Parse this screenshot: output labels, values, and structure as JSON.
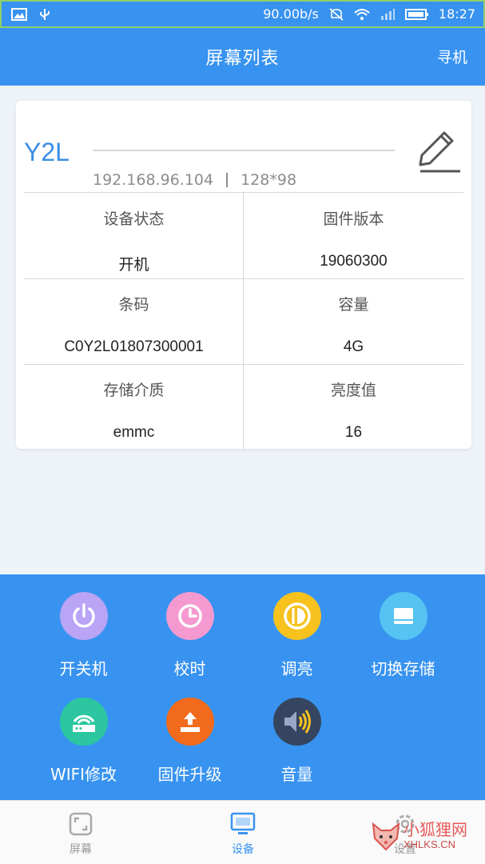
{
  "status_bar": {
    "speed": "90.00b/s",
    "time": "18:27"
  },
  "header": {
    "title": "屏幕列表",
    "action": "寻机"
  },
  "device": {
    "name": "Y2L",
    "ip": "192.168.96.104",
    "resolution": "128*98"
  },
  "info": [
    {
      "label": "设备状态",
      "value": "开机"
    },
    {
      "label": "固件版本",
      "value": "19060300"
    },
    {
      "label": "条码",
      "value": "C0Y2L01807300001"
    },
    {
      "label": "容量",
      "value": "4G"
    },
    {
      "label": "存储介质",
      "value": "emmc"
    },
    {
      "label": "亮度值",
      "value": "16"
    }
  ],
  "controls": [
    {
      "label": "开关机",
      "icon": "power-icon",
      "color": "#b9a4f5"
    },
    {
      "label": "校时",
      "icon": "clock-icon",
      "color": "#f59ad0"
    },
    {
      "label": "调亮",
      "icon": "brightness-icon",
      "color": "#f7c21e"
    },
    {
      "label": "切换存储",
      "icon": "storage-icon",
      "color": "#56c4f2"
    },
    {
      "label": "WIFI修改",
      "icon": "wifi-router-icon",
      "color": "#2cc7a0"
    },
    {
      "label": "固件升级",
      "icon": "upload-icon",
      "color": "#f26a1b"
    },
    {
      "label": "音量",
      "icon": "volume-icon",
      "color": "#36455f"
    }
  ],
  "nav": [
    {
      "label": "屏幕",
      "icon": "screen-icon"
    },
    {
      "label": "设备",
      "icon": "device-icon"
    },
    {
      "label": "设置",
      "icon": "settings-icon"
    }
  ],
  "watermark": {
    "text": "小狐狸网",
    "sub": "XHLKS.CN"
  },
  "colors": {
    "primary": "#3893f0",
    "device_name": "#3a8ee6"
  }
}
